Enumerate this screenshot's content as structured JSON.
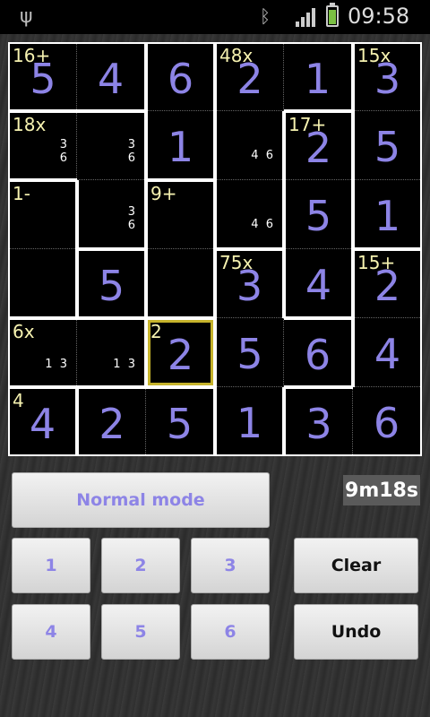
{
  "status_bar": {
    "time": "09:58",
    "icons": [
      "usb-icon",
      "bluetooth-icon",
      "signal-icon",
      "battery-charging-icon"
    ]
  },
  "board": {
    "size": 6,
    "rows": [
      [
        {
          "value": "5",
          "cage": "16+"
        },
        {
          "value": "4"
        },
        {
          "value": "6"
        },
        {
          "value": "2",
          "cage": "48x"
        },
        {
          "value": "1"
        },
        {
          "value": "3",
          "cage": "15x"
        }
      ],
      [
        {
          "value": "",
          "cage": "18x",
          "notes": "3\n6"
        },
        {
          "value": "",
          "notes": "3\n6"
        },
        {
          "value": "1"
        },
        {
          "value": "",
          "notes": "4  6"
        },
        {
          "value": "2",
          "cage": "17+"
        },
        {
          "value": "5"
        }
      ],
      [
        {
          "value": "",
          "cage": "1-"
        },
        {
          "value": "",
          "notes": "3\n6"
        },
        {
          "value": "",
          "cage": "9+"
        },
        {
          "value": "",
          "notes": "4  6"
        },
        {
          "value": "5"
        },
        {
          "value": "1"
        }
      ],
      [
        {
          "value": ""
        },
        {
          "value": "5"
        },
        {
          "value": ""
        },
        {
          "value": "3",
          "cage": "75x"
        },
        {
          "value": "4"
        },
        {
          "value": "2",
          "cage": "15+"
        }
      ],
      [
        {
          "value": "",
          "cage": "6x",
          "notes": "1  3"
        },
        {
          "value": "",
          "notes": "1  3"
        },
        {
          "value": "2",
          "cage": "2",
          "selected": true
        },
        {
          "value": "5"
        },
        {
          "value": "6"
        },
        {
          "value": "4"
        }
      ],
      [
        {
          "value": "4",
          "cage": "4"
        },
        {
          "value": "2"
        },
        {
          "value": "5"
        },
        {
          "value": "1"
        },
        {
          "value": "3"
        },
        {
          "value": "6"
        }
      ]
    ]
  },
  "controls": {
    "mode_label": "Normal mode",
    "timer": "9m18s",
    "digits": [
      "1",
      "2",
      "3",
      "4",
      "5",
      "6"
    ],
    "clear_label": "Clear",
    "undo_label": "Undo"
  }
}
